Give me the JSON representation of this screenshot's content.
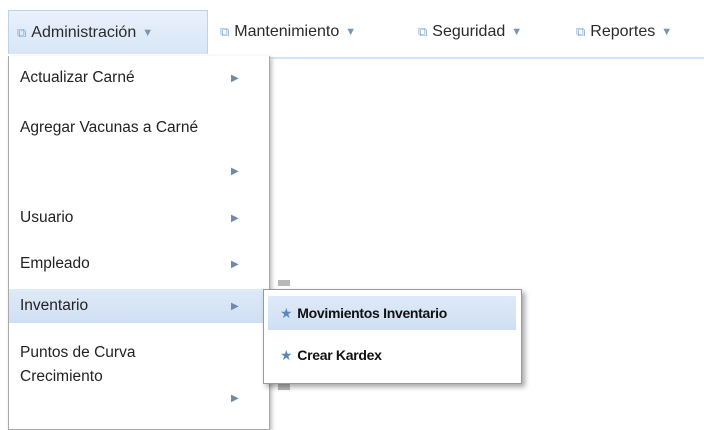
{
  "menubar": {
    "items": [
      {
        "label": "Administración",
        "icon": "window-icon"
      },
      {
        "label": "Mantenimiento",
        "icon": "window-icon"
      },
      {
        "label": "Seguridad",
        "icon": "window-icon"
      },
      {
        "label": "Reportes",
        "icon": "window-icon"
      }
    ]
  },
  "dropdown": {
    "items": [
      {
        "label": "Actualizar Carné"
      },
      {
        "label": "Agregar Vacunas a Carné"
      },
      {
        "label": "Usuario"
      },
      {
        "label": "Empleado"
      },
      {
        "label": "Inventario"
      },
      {
        "label": "Puntos de Curva Crecimiento"
      }
    ]
  },
  "submenu": {
    "items": [
      {
        "label": "Movimientos Inventario"
      },
      {
        "label": "Crear Kardex"
      }
    ]
  },
  "colors": {
    "accent": "#cfdff3",
    "icon": "#7ea7d3",
    "star": "#5a87c0"
  }
}
